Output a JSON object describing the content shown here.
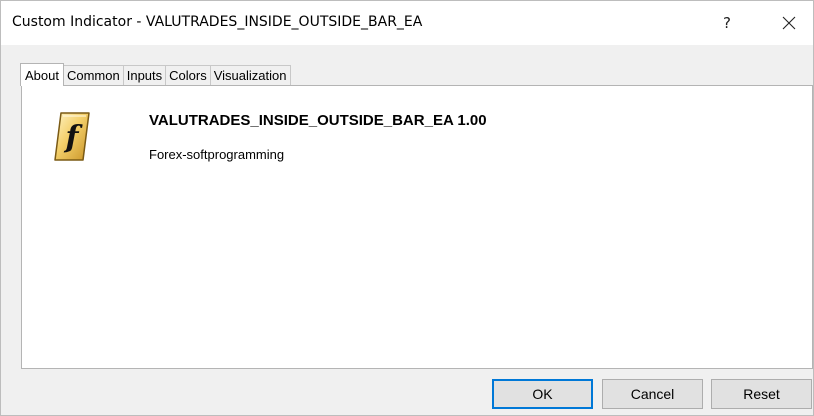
{
  "window": {
    "title": "Custom Indicator - VALUTRADES_INSIDE_OUTSIDE_BAR_EA",
    "help_label": "?"
  },
  "tabs": [
    {
      "label": "About",
      "active": true
    },
    {
      "label": "Common",
      "active": false
    },
    {
      "label": "Inputs",
      "active": false
    },
    {
      "label": "Colors",
      "active": false
    },
    {
      "label": "Visualization",
      "active": false
    }
  ],
  "about": {
    "icon": "function-f-icon",
    "name": "VALUTRADES_INSIDE_OUTSIDE_BAR_EA 1.00",
    "author": "Forex-softprogramming"
  },
  "buttons": {
    "ok_label": "OK",
    "cancel_label": "Cancel",
    "reset_label": "Reset"
  },
  "colors": {
    "accent": "#0078d7",
    "icon_gold": "#e8b640"
  }
}
